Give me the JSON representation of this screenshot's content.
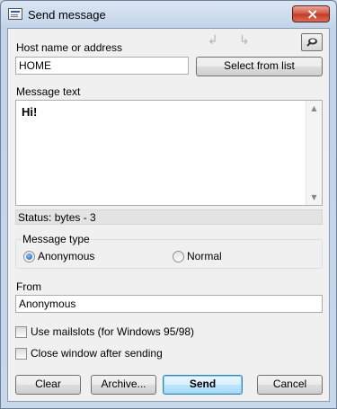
{
  "window": {
    "title": "Send message"
  },
  "host": {
    "label": "Host name or address",
    "value": "HOME",
    "select_button": "Select from list"
  },
  "message": {
    "label": "Message text",
    "value": "Hi!"
  },
  "status": {
    "text": "Status: bytes - 3"
  },
  "message_type": {
    "label": "Message type",
    "options": [
      "Anonymous",
      "Normal"
    ],
    "selected": "Anonymous"
  },
  "from": {
    "label": "From",
    "value": "Anonymous"
  },
  "options": {
    "mailslots": "Use mailslots (for Windows 95/98)",
    "close_after": "Close window after sending"
  },
  "buttons": {
    "clear": "Clear",
    "archive": "Archive...",
    "send": "Send",
    "cancel": "Cancel"
  },
  "colors": {
    "accent": "#3c7fb1",
    "close": "#c23a25"
  },
  "icons": [
    "window-icon",
    "close-icon",
    "arrow-left-icon",
    "arrow-right-icon",
    "pin-icon",
    "scroll-up-icon",
    "scroll-down-icon"
  ]
}
